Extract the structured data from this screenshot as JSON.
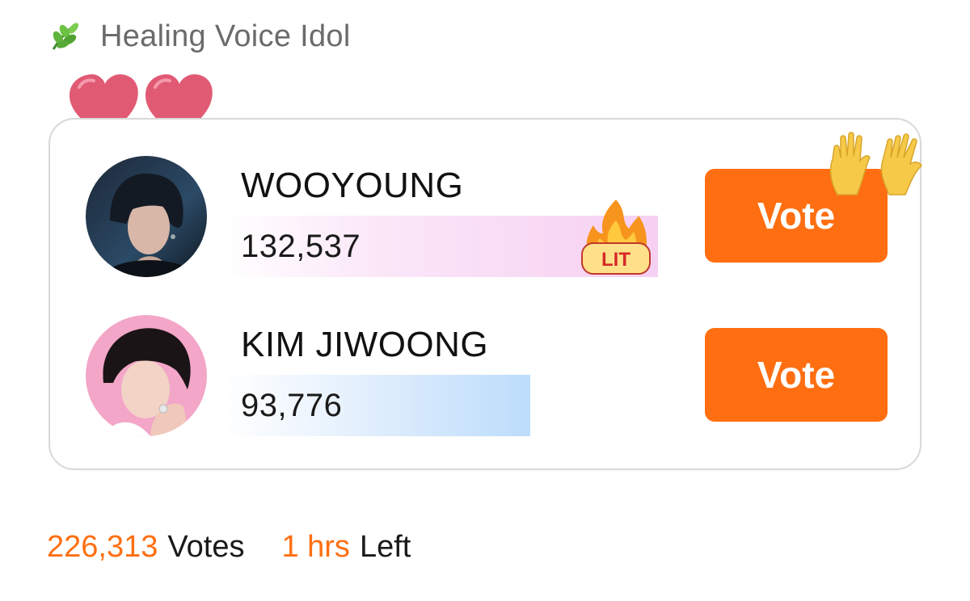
{
  "header": {
    "icon": "leaf-icon",
    "title": "Healing Voice Idol"
  },
  "decorations": {
    "hearts": "heart-icon",
    "lit": "lit-fire-icon",
    "hands": "raised-hands-icon"
  },
  "candidates": [
    {
      "name": "WOOYOUNG",
      "votes": "132,537",
      "vote_label": "Vote",
      "bar_share": 1.0,
      "bar_color": "#f6d0f3"
    },
    {
      "name": "KIM JIWOONG",
      "votes": "93,776",
      "vote_label": "Vote",
      "bar_share": 0.705,
      "bar_color": "#bcdcfb"
    }
  ],
  "footer": {
    "total_votes": "226,313",
    "votes_label": "Votes",
    "time_left": "1 hrs",
    "left_label": "Left"
  },
  "colors": {
    "accent": "#ff6f12",
    "title_gray": "#6b6b6b",
    "card_border": "#d8d8d8"
  }
}
